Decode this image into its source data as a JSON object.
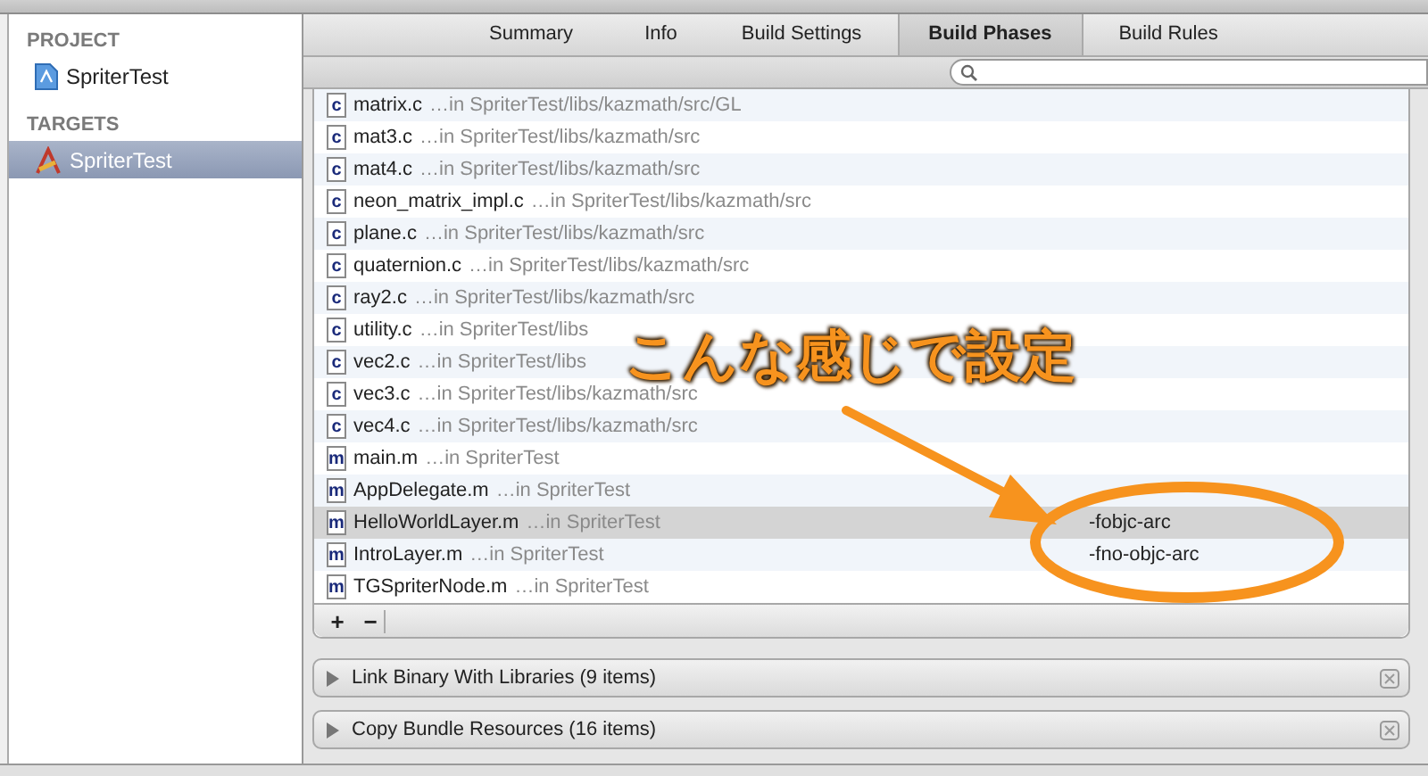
{
  "sidebar": {
    "sections": [
      {
        "header": "PROJECT",
        "items": [
          {
            "label": "SpriterTest",
            "kind": "project",
            "selected": false
          }
        ]
      },
      {
        "header": "TARGETS",
        "items": [
          {
            "label": "SpriterTest",
            "kind": "target",
            "selected": true
          }
        ]
      }
    ]
  },
  "tabs": [
    {
      "label": "Summary",
      "selected": false
    },
    {
      "label": "Info",
      "selected": false
    },
    {
      "label": "Build Settings",
      "selected": false
    },
    {
      "label": "Build Phases",
      "selected": true
    },
    {
      "label": "Build Rules",
      "selected": false
    }
  ],
  "files": [
    {
      "icon": "c",
      "name": "matrix.c",
      "path": "…in SpriterTest/libs/kazmath/src/GL",
      "selected": false
    },
    {
      "icon": "c",
      "name": "mat3.c",
      "path": "…in SpriterTest/libs/kazmath/src",
      "selected": false
    },
    {
      "icon": "c",
      "name": "mat4.c",
      "path": "…in SpriterTest/libs/kazmath/src",
      "selected": false
    },
    {
      "icon": "c",
      "name": "neon_matrix_impl.c",
      "path": "…in SpriterTest/libs/kazmath/src",
      "selected": false
    },
    {
      "icon": "c",
      "name": "plane.c",
      "path": "…in SpriterTest/libs/kazmath/src",
      "selected": false
    },
    {
      "icon": "c",
      "name": "quaternion.c",
      "path": "…in SpriterTest/libs/kazmath/src",
      "selected": false
    },
    {
      "icon": "c",
      "name": "ray2.c",
      "path": "…in SpriterTest/libs/kazmath/src",
      "selected": false
    },
    {
      "icon": "c",
      "name": "utility.c",
      "path": "…in SpriterTest/libs",
      "selected": false
    },
    {
      "icon": "c",
      "name": "vec2.c",
      "path": "…in SpriterTest/libs",
      "selected": false
    },
    {
      "icon": "c",
      "name": "vec3.c",
      "path": "…in SpriterTest/libs/kazmath/src",
      "selected": false
    },
    {
      "icon": "c",
      "name": "vec4.c",
      "path": "…in SpriterTest/libs/kazmath/src",
      "selected": false
    },
    {
      "icon": "m",
      "name": "main.m",
      "path": "…in SpriterTest",
      "selected": false
    },
    {
      "icon": "m",
      "name": "AppDelegate.m",
      "path": "…in SpriterTest",
      "selected": false
    },
    {
      "icon": "m",
      "name": "HelloWorldLayer.m",
      "path": "…in SpriterTest",
      "flags": "-fobjc-arc",
      "selected": true
    },
    {
      "icon": "m",
      "name": "IntroLayer.m",
      "path": "…in SpriterTest",
      "flags": "-fno-objc-arc",
      "selected": false
    },
    {
      "icon": "m",
      "name": "TGSpriterNode.m",
      "path": "…in SpriterTest",
      "selected": false
    }
  ],
  "list_toolbar": {
    "add": "+",
    "remove": "−"
  },
  "phases": [
    {
      "title": "Link Binary With Libraries (9 items)",
      "expanded": false
    },
    {
      "title": "Copy Bundle Resources (16 items)",
      "expanded": false
    }
  ],
  "annotation": {
    "text": "こんな感じで設定"
  }
}
